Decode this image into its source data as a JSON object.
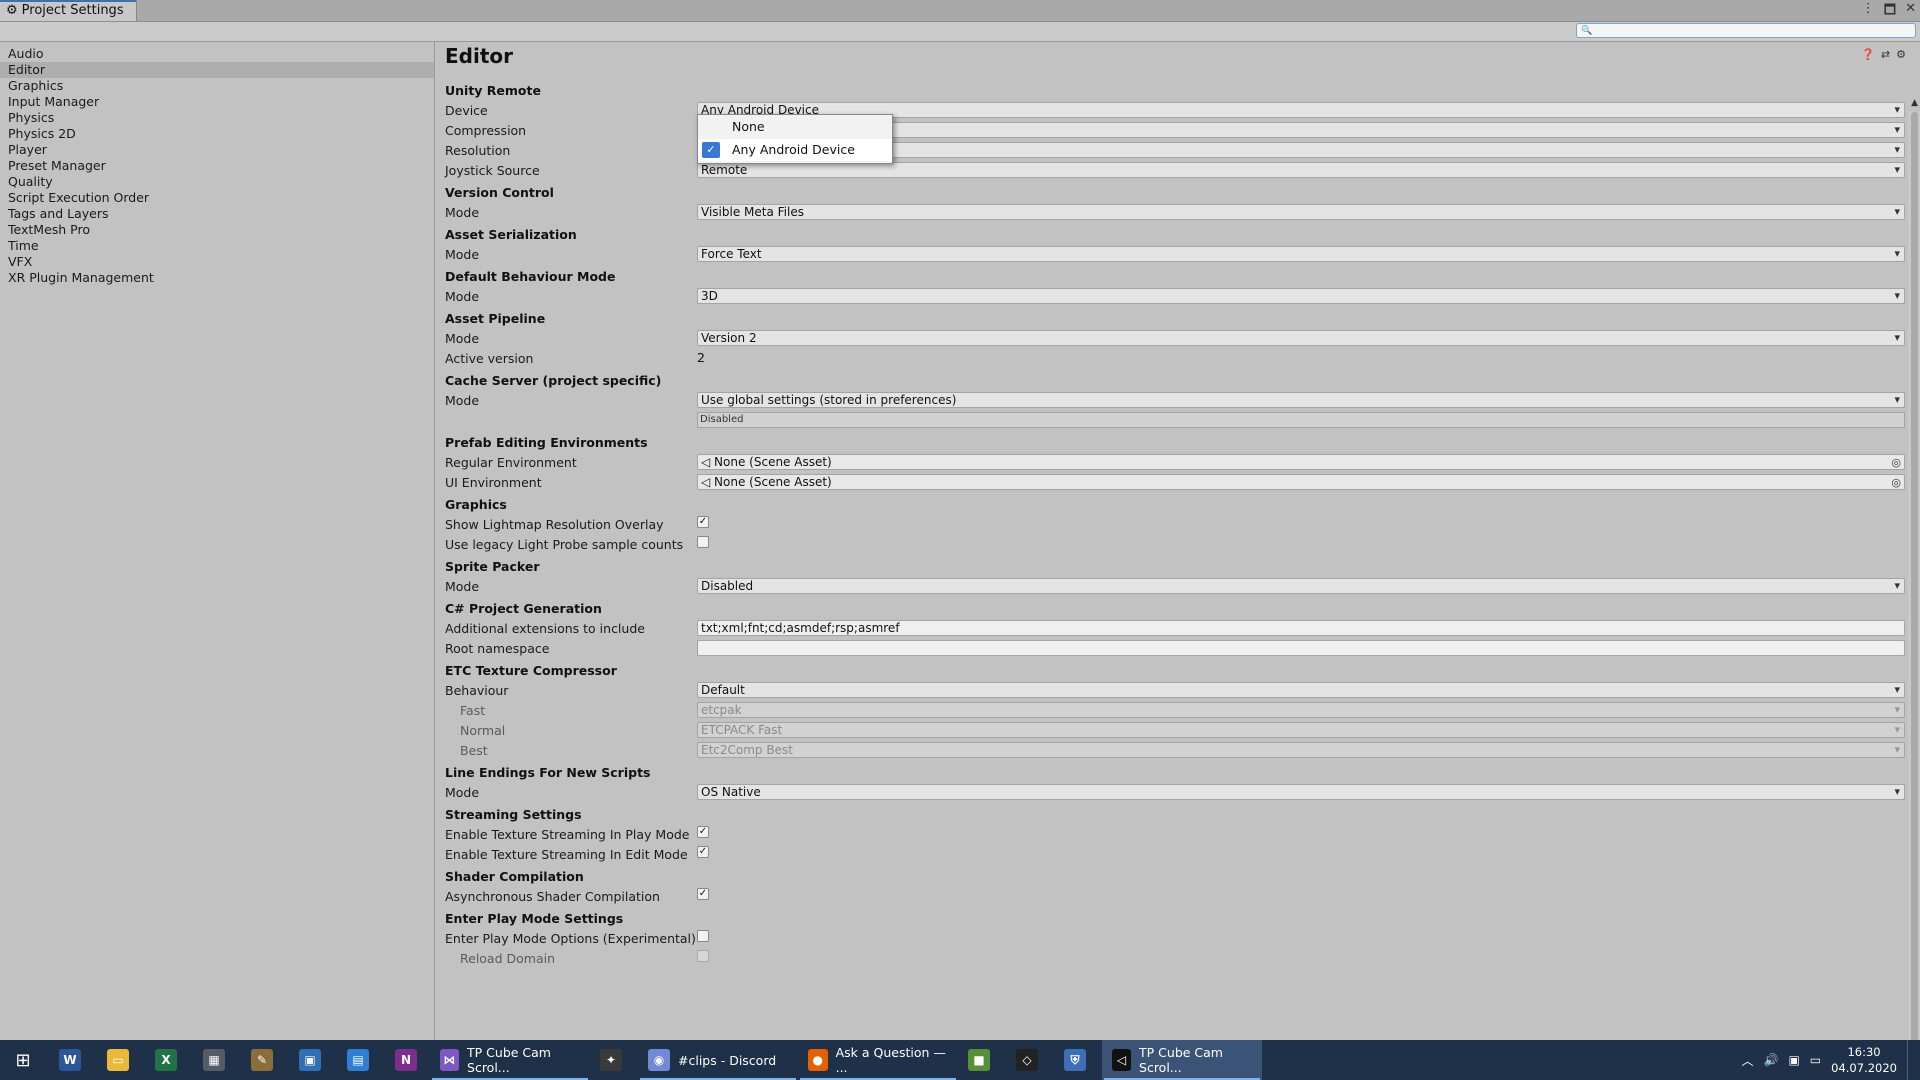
{
  "window": {
    "tab_label": "Project Settings",
    "tab_icon": "gear-icon",
    "controls": [
      "⋮",
      "🗖",
      "✕"
    ],
    "search_placeholder": ""
  },
  "sidebar": {
    "items": [
      {
        "label": "Audio"
      },
      {
        "label": "Editor",
        "selected": true
      },
      {
        "label": "Graphics"
      },
      {
        "label": "Input Manager"
      },
      {
        "label": "Physics"
      },
      {
        "label": "Physics 2D"
      },
      {
        "label": "Player"
      },
      {
        "label": "Preset Manager"
      },
      {
        "label": "Quality"
      },
      {
        "label": "Script Execution Order"
      },
      {
        "label": "Tags and Layers"
      },
      {
        "label": "TextMesh Pro"
      },
      {
        "label": "Time"
      },
      {
        "label": "VFX"
      },
      {
        "label": "XR Plugin Management"
      }
    ]
  },
  "editor": {
    "title": "Editor",
    "unity_remote": {
      "header": "Unity Remote",
      "device_label": "Device",
      "device_value": "Any Android Device",
      "compression_label": "Compression",
      "compression_value": "",
      "resolution_label": "Resolution",
      "resolution_value": "",
      "joystick_label": "Joystick Source",
      "joystick_value": "Remote"
    },
    "device_popup": {
      "options": [
        "None",
        "Any Android Device"
      ],
      "selected": "Any Android Device"
    },
    "version_control": {
      "header": "Version Control",
      "mode_label": "Mode",
      "mode_value": "Visible Meta Files"
    },
    "asset_serialization": {
      "header": "Asset Serialization",
      "mode_label": "Mode",
      "mode_value": "Force Text"
    },
    "default_behaviour": {
      "header": "Default Behaviour Mode",
      "mode_label": "Mode",
      "mode_value": "3D"
    },
    "asset_pipeline": {
      "header": "Asset Pipeline",
      "mode_label": "Mode",
      "mode_value": "Version 2",
      "active_label": "Active version",
      "active_value": "2"
    },
    "cache_server": {
      "header": "Cache Server (project specific)",
      "mode_label": "Mode",
      "mode_value": "Use global settings (stored in preferences)",
      "status": "Disabled"
    },
    "prefab": {
      "header": "Prefab Editing Environments",
      "regular_label": "Regular Environment",
      "regular_value": "None (Scene Asset)",
      "ui_label": "UI Environment",
      "ui_value": "None (Scene Asset)"
    },
    "graphics": {
      "header": "Graphics",
      "lightmap_label": "Show Lightmap Resolution Overlay",
      "lightmap_checked": true,
      "legacy_label": "Use legacy Light Probe sample counts",
      "legacy_checked": false
    },
    "sprite_packer": {
      "header": "Sprite Packer",
      "mode_label": "Mode",
      "mode_value": "Disabled"
    },
    "csharp": {
      "header": "C# Project Generation",
      "ext_label": "Additional extensions to include",
      "ext_value": "txt;xml;fnt;cd;asmdef;rsp;asmref",
      "ns_label": "Root namespace",
      "ns_value": ""
    },
    "etc": {
      "header": "ETC Texture Compressor",
      "behaviour_label": "Behaviour",
      "behaviour_value": "Default",
      "fast_label": "Fast",
      "fast_value": "etcpak",
      "normal_label": "Normal",
      "normal_value": "ETCPACK Fast",
      "best_label": "Best",
      "best_value": "Etc2Comp Best"
    },
    "line_endings": {
      "header": "Line Endings For New Scripts",
      "mode_label": "Mode",
      "mode_value": "OS Native"
    },
    "streaming": {
      "header": "Streaming Settings",
      "play_label": "Enable Texture Streaming In Play Mode",
      "play_checked": true,
      "edit_label": "Enable Texture Streaming In Edit Mode",
      "edit_checked": true
    },
    "shader": {
      "header": "Shader Compilation",
      "async_label": "Asynchronous Shader Compilation",
      "async_checked": true
    },
    "play_mode": {
      "header": "Enter Play Mode Settings",
      "options_label": "Enter Play Mode Options (Experimental)",
      "options_checked": false,
      "reload_label": "Reload Domain",
      "reload_checked": false
    }
  },
  "taskbar": {
    "pinned": [
      {
        "icon": "word-icon",
        "glyph": "W",
        "color": "#2b579a"
      },
      {
        "icon": "file-explorer-icon",
        "glyph": "▭",
        "color": "#e8b93a"
      },
      {
        "icon": "excel-icon",
        "glyph": "X",
        "color": "#217346"
      },
      {
        "icon": "calculator-icon",
        "glyph": "▦",
        "color": "#555c66"
      },
      {
        "icon": "paint-icon",
        "glyph": "✎",
        "color": "#8a6d3b"
      },
      {
        "icon": "remote-desktop-icon",
        "glyph": "▣",
        "color": "#2f6fb5"
      },
      {
        "icon": "calendar-icon",
        "glyph": "▤",
        "color": "#2e7fd1"
      },
      {
        "icon": "onenote-icon",
        "glyph": "N",
        "color": "#7b2e8f"
      }
    ],
    "apps": [
      {
        "label": "TP Cube Cam Scrol...",
        "icon": "visual-studio-icon",
        "glyph": "⋈",
        "color": "#7e57c2",
        "open": true
      },
      {
        "label": "",
        "icon": "game-icon",
        "glyph": "✦",
        "color": "#3a3a3a",
        "open": false
      },
      {
        "label": "#clips - Discord",
        "icon": "discord-icon",
        "glyph": "◉",
        "color": "#7289da",
        "open": true
      },
      {
        "label": "Ask a Question — ...",
        "icon": "firefox-icon",
        "glyph": "●",
        "color": "#e66000",
        "open": true
      },
      {
        "label": "",
        "icon": "minecraft-icon",
        "glyph": "■",
        "color": "#5a8f3a",
        "open": false
      },
      {
        "label": "",
        "icon": "unity-hub-icon",
        "glyph": "◇",
        "color": "#222222",
        "open": false
      },
      {
        "label": "",
        "icon": "shield-icon",
        "glyph": "⛨",
        "color": "#3d6fb6",
        "open": false
      },
      {
        "label": "TP Cube Cam Scrol...",
        "icon": "unity-icon",
        "glyph": "◁",
        "color": "#111111",
        "open": true,
        "active": true
      }
    ],
    "time": "16:30",
    "date": "04.07.2020"
  }
}
